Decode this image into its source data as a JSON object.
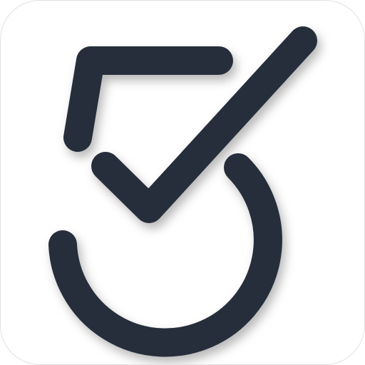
{
  "app_icon": {
    "icon": "five-checkmark-logo-icon",
    "background_color": "#ffffff",
    "mark_color": "#272d3a",
    "border_color": "#e2e2e2"
  }
}
